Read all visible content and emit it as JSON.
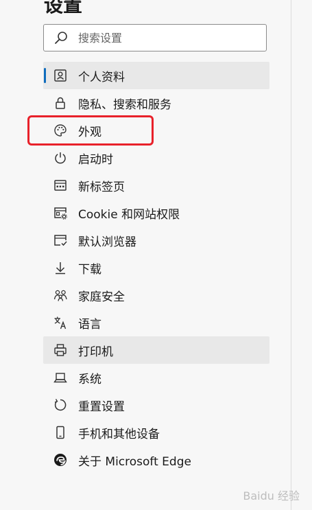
{
  "page": {
    "title": "设置"
  },
  "search": {
    "placeholder": "搜索设置"
  },
  "nav": {
    "items": [
      {
        "label": "个人资料",
        "icon": "profile-icon"
      },
      {
        "label": "隐私、搜索和服务",
        "icon": "lock-icon"
      },
      {
        "label": "外观",
        "icon": "palette-icon"
      },
      {
        "label": "启动时",
        "icon": "power-icon"
      },
      {
        "label": "新标签页",
        "icon": "new-tab-icon"
      },
      {
        "label": "Cookie 和网站权限",
        "icon": "site-permissions-icon"
      },
      {
        "label": "默认浏览器",
        "icon": "default-browser-icon"
      },
      {
        "label": "下载",
        "icon": "download-icon"
      },
      {
        "label": "家庭安全",
        "icon": "family-icon"
      },
      {
        "label": "语言",
        "icon": "language-icon"
      },
      {
        "label": "打印机",
        "icon": "printer-icon"
      },
      {
        "label": "系统",
        "icon": "laptop-icon"
      },
      {
        "label": "重置设置",
        "icon": "reset-icon"
      },
      {
        "label": "手机和其他设备",
        "icon": "phone-icon"
      },
      {
        "label": "关于 Microsoft Edge",
        "icon": "edge-logo-icon"
      }
    ]
  },
  "watermark": "Baidu 经验",
  "colors": {
    "accent": "#0f6cbd",
    "highlight": "#e8212a",
    "selected_bg": "#e8e8e8"
  }
}
